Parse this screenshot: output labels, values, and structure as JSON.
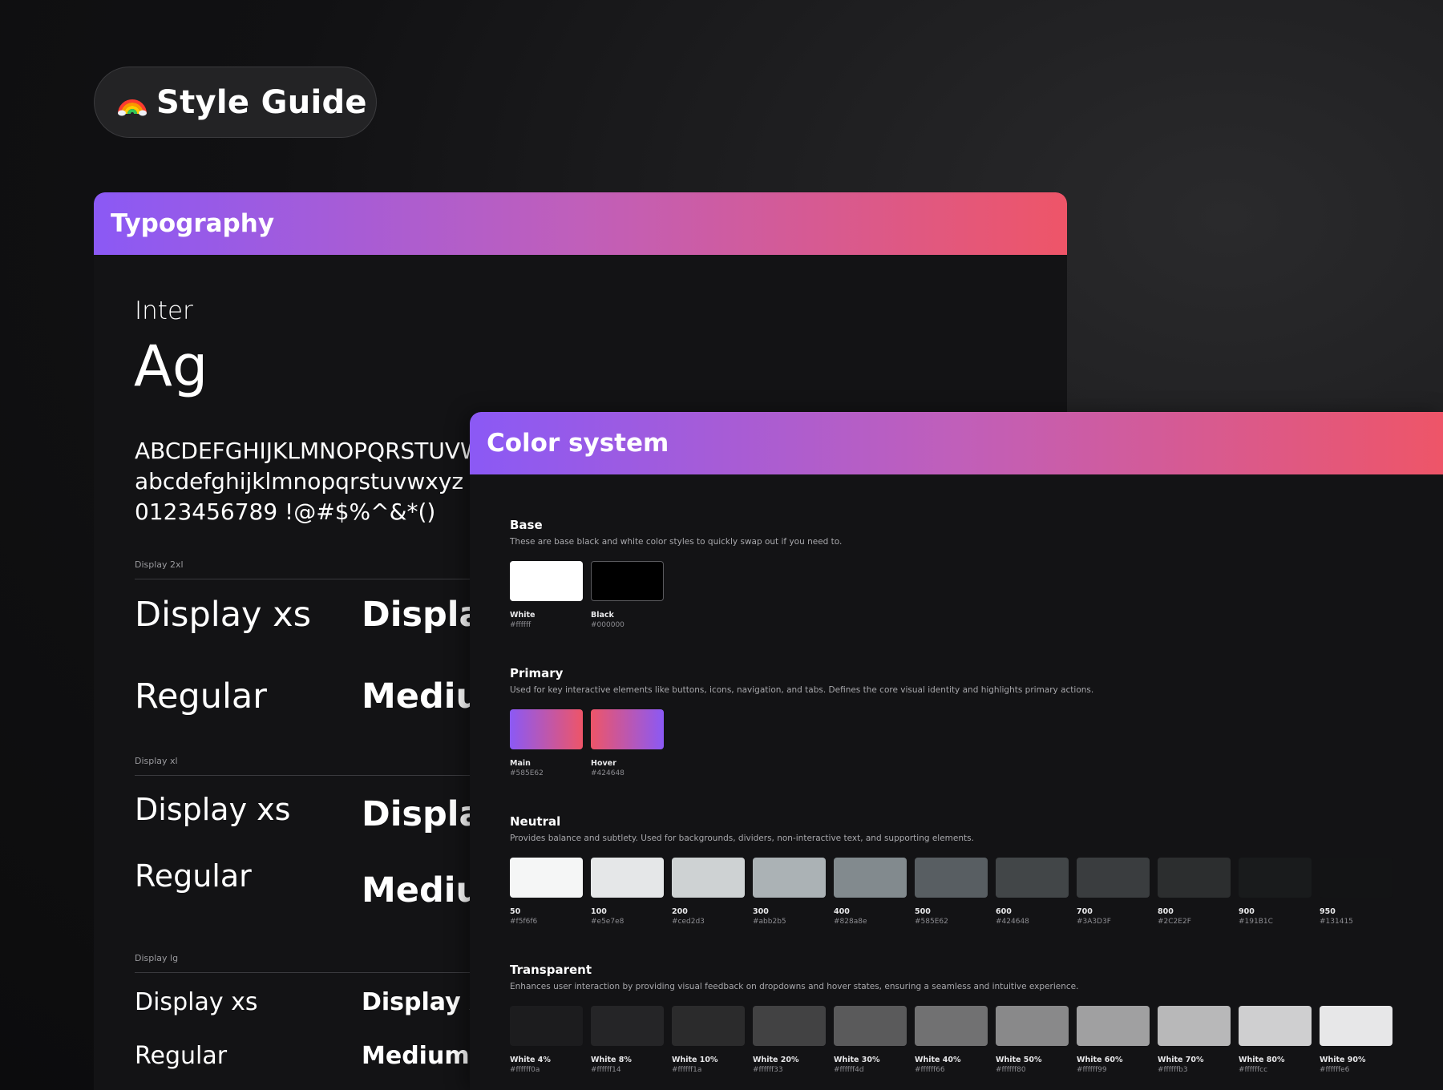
{
  "page": {
    "title": "Style Guide",
    "icon": "rainbow-icon"
  },
  "typography": {
    "header": "Typography",
    "font_name": "Inter",
    "specimen": "Ag",
    "uppercase": "ABCDEFGHIJKLMNOPQRSTUVWXYZ",
    "lowercase": "abcdefghijklmnopqrstuvwxyz",
    "numerals": "0123456789 !@#$%^&*()",
    "groups": [
      {
        "label": "Display 2xl",
        "row1": [
          "Display xs",
          "Display xs"
        ],
        "row2": [
          "Regular",
          "Medium"
        ]
      },
      {
        "label": "Display xl",
        "row1": [
          "Display xs",
          "Display xs"
        ],
        "row2": [
          "Regular",
          "Medium"
        ]
      },
      {
        "label": "Display lg",
        "row1": [
          "Display xs",
          "Display xs"
        ],
        "row2": [
          "Regular",
          "Medium"
        ]
      }
    ]
  },
  "colors": {
    "header": "Color system",
    "sections": [
      {
        "title": "Base",
        "desc": "These are base black and white color styles to quickly swap out if you need to.",
        "swatches": [
          {
            "name": "White",
            "hex": "#ffffff",
            "fill": "#ffffff"
          },
          {
            "name": "Black",
            "hex": "#000000",
            "fill": "#000000"
          }
        ]
      },
      {
        "title": "Primary",
        "desc": "Used for key interactive elements like buttons, icons, navigation, and tabs. Defines the core visual identity and highlights primary actions.",
        "swatches": [
          {
            "name": "Main",
            "hex": "#585E62",
            "fill": "linear-gradient(90deg,#8b59f5,#ee5568)"
          },
          {
            "name": "Hover",
            "hex": "#424648",
            "fill": "linear-gradient(90deg,#ee5568,#8b59f5)"
          }
        ]
      },
      {
        "title": "Neutral",
        "desc": "Provides balance and subtlety. Used for backgrounds, dividers, non-interactive text, and supporting elements.",
        "swatches": [
          {
            "name": "50",
            "hex": "#f5f6f6",
            "fill": "#f5f6f6"
          },
          {
            "name": "100",
            "hex": "#e5e7e8",
            "fill": "#e5e7e8"
          },
          {
            "name": "200",
            "hex": "#ced2d3",
            "fill": "#ced2d3"
          },
          {
            "name": "300",
            "hex": "#abb2b5",
            "fill": "#abb2b5"
          },
          {
            "name": "400",
            "hex": "#828a8e",
            "fill": "#828a8e"
          },
          {
            "name": "500",
            "hex": "#585E62",
            "fill": "#585E62"
          },
          {
            "name": "600",
            "hex": "#424648",
            "fill": "#424648"
          },
          {
            "name": "700",
            "hex": "#3A3D3F",
            "fill": "#3A3D3F"
          },
          {
            "name": "800",
            "hex": "#2C2E2F",
            "fill": "#2C2E2F"
          },
          {
            "name": "900",
            "hex": "#191B1C",
            "fill": "#191B1C"
          },
          {
            "name": "950",
            "hex": "#131415",
            "fill": "#131415"
          }
        ]
      },
      {
        "title": "Transparent",
        "desc": "Enhances user interaction by providing visual feedback on dropdowns and hover states, ensuring a seamless and intuitive experience.",
        "swatches": [
          {
            "name": "White 4%",
            "hex": "#ffffff0a",
            "fill": "rgba(255,255,255,0.04)"
          },
          {
            "name": "White 8%",
            "hex": "#ffffff14",
            "fill": "rgba(255,255,255,0.08)"
          },
          {
            "name": "White 10%",
            "hex": "#ffffff1a",
            "fill": "rgba(255,255,255,0.10)"
          },
          {
            "name": "White 20%",
            "hex": "#ffffff33",
            "fill": "rgba(255,255,255,0.20)"
          },
          {
            "name": "White 30%",
            "hex": "#ffffff4d",
            "fill": "rgba(255,255,255,0.30)"
          },
          {
            "name": "White 40%",
            "hex": "#ffffff66",
            "fill": "rgba(255,255,255,0.40)"
          },
          {
            "name": "White 50%",
            "hex": "#ffffff80",
            "fill": "rgba(255,255,255,0.50)"
          },
          {
            "name": "White 60%",
            "hex": "#ffffff99",
            "fill": "rgba(255,255,255,0.60)"
          },
          {
            "name": "White 70%",
            "hex": "#ffffffb3",
            "fill": "rgba(255,255,255,0.70)"
          },
          {
            "name": "White 80%",
            "hex": "#ffffffcc",
            "fill": "rgba(255,255,255,0.80)"
          },
          {
            "name": "White 90%",
            "hex": "#ffffffe6",
            "fill": "rgba(255,255,255,0.90)"
          }
        ]
      }
    ]
  }
}
